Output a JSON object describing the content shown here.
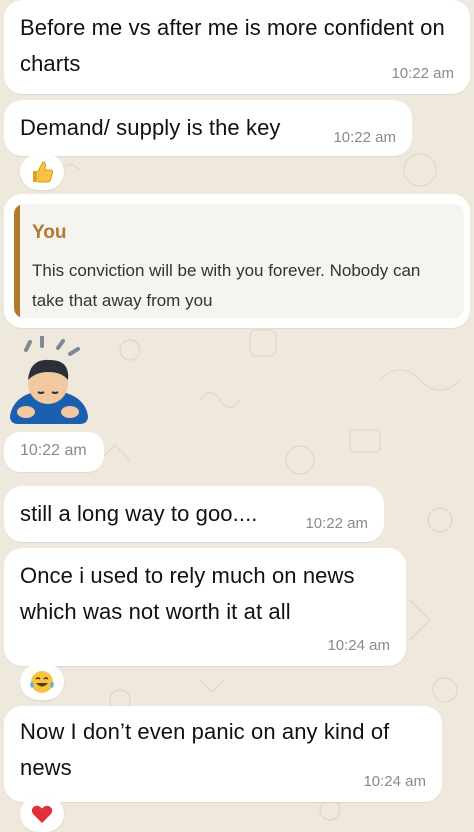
{
  "messages": {
    "m1": {
      "text": "Before me vs after me is more confident on charts",
      "time": "10:22 am"
    },
    "m2": {
      "text": "Demand/ supply is the key",
      "time": "10:22 am"
    },
    "quote": {
      "author": "You",
      "text": "This conviction will be with you forever. Nobody can take that away from you"
    },
    "sticker": {
      "time": "10:22 am",
      "icon": "bowing-person-emoji"
    },
    "m3": {
      "text": "still a long way to goo....",
      "time": "10:22 am"
    },
    "m4": {
      "text": "Once i used to rely much on news which was not worth it at all",
      "time": "10:24 am"
    },
    "m5": {
      "text": "Now I don’t even panic on any kind of news",
      "time": "10:24 am"
    }
  },
  "reactions": {
    "r1": "thumbs-up-emoji",
    "r2": "tears-of-joy-emoji",
    "r3": "red-heart-emoji"
  },
  "colors": {
    "background": "#efe8dc",
    "bubble": "#ffffff",
    "quote_accent": "#b07a2a",
    "timestamp": "#8a8a8a"
  }
}
